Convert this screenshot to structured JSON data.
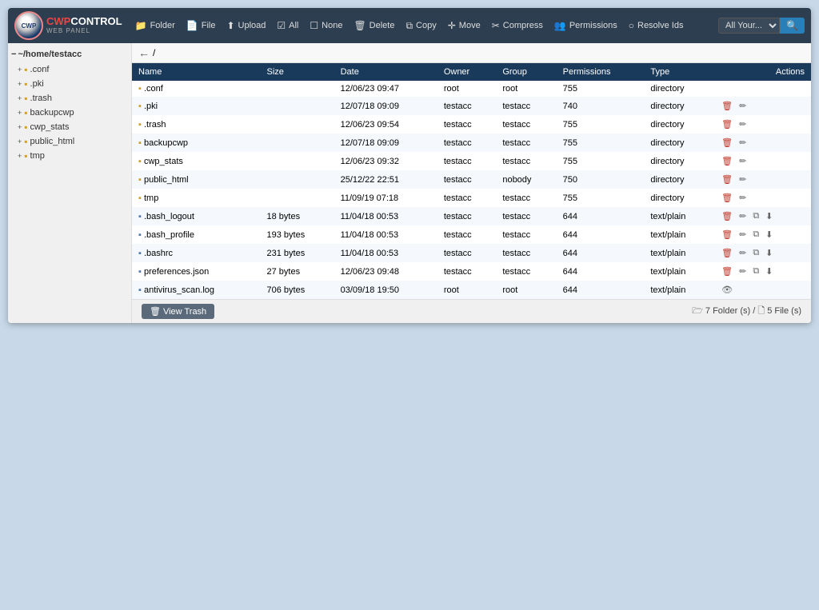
{
  "logo": {
    "cwp": "CWP",
    "control": "CONTROL",
    "sub": "WEB PANEL"
  },
  "toolbar": {
    "folder_label": "Folder",
    "file_label": "File",
    "upload_label": "Upload",
    "all_label": "All",
    "none_label": "None",
    "delete_label": "Delete",
    "copy_label": "Copy",
    "move_label": "Move",
    "compress_label": "Compress",
    "permissions_label": "Permissions",
    "resolve_ids_label": "Resolve Ids",
    "search_placeholder": "All Your...",
    "search_options": [
      "All Your..."
    ]
  },
  "sidebar": {
    "root_label": "~/home/testacc",
    "items": [
      {
        "name": ".conf",
        "indent": 1
      },
      {
        "name": ".pki",
        "indent": 1
      },
      {
        "name": ".trash",
        "indent": 1
      },
      {
        "name": "backupcwp",
        "indent": 1
      },
      {
        "name": "cwp_stats",
        "indent": 1
      },
      {
        "name": "public_html",
        "indent": 1
      },
      {
        "name": "tmp",
        "indent": 1
      }
    ]
  },
  "nav": {
    "back_char": "←",
    "separator": "/"
  },
  "table": {
    "headers": [
      "Name",
      "Size",
      "Date",
      "Owner",
      "Group",
      "Permissions",
      "Type",
      "Actions"
    ],
    "rows": [
      {
        "name": ".conf",
        "size": "",
        "date": "12/06/23 09:47",
        "owner": "root",
        "group": "root",
        "perms": "755",
        "type": "directory",
        "is_dir": true,
        "actions": []
      },
      {
        "name": ".pki",
        "size": "",
        "date": "12/07/18 09:09",
        "owner": "testacc",
        "group": "testacc",
        "perms": "740",
        "type": "directory",
        "is_dir": true,
        "actions": [
          "delete",
          "edit"
        ]
      },
      {
        "name": ".trash",
        "size": "",
        "date": "12/06/23 09:54",
        "owner": "testacc",
        "group": "testacc",
        "perms": "755",
        "type": "directory",
        "is_dir": true,
        "actions": [
          "delete",
          "edit"
        ]
      },
      {
        "name": "backupcwp",
        "size": "",
        "date": "12/07/18 09:09",
        "owner": "testacc",
        "group": "testacc",
        "perms": "755",
        "type": "directory",
        "is_dir": true,
        "actions": [
          "delete",
          "edit"
        ]
      },
      {
        "name": "cwp_stats",
        "size": "",
        "date": "12/06/23 09:32",
        "owner": "testacc",
        "group": "testacc",
        "perms": "755",
        "type": "directory",
        "is_dir": true,
        "actions": [
          "delete",
          "edit"
        ]
      },
      {
        "name": "public_html",
        "size": "",
        "date": "25/12/22 22:51",
        "owner": "testacc",
        "group": "nobody",
        "perms": "750",
        "type": "directory",
        "is_dir": true,
        "actions": [
          "delete",
          "edit"
        ]
      },
      {
        "name": "tmp",
        "size": "",
        "date": "11/09/19 07:18",
        "owner": "testacc",
        "group": "testacc",
        "perms": "755",
        "type": "directory",
        "is_dir": true,
        "actions": [
          "delete",
          "edit"
        ]
      },
      {
        "name": ".bash_logout",
        "size": "18 bytes",
        "date": "11/04/18 00:53",
        "owner": "testacc",
        "group": "testacc",
        "perms": "644",
        "type": "text/plain",
        "is_dir": false,
        "actions": [
          "delete",
          "edit",
          "copy",
          "download"
        ]
      },
      {
        "name": ".bash_profile",
        "size": "193 bytes",
        "date": "11/04/18 00:53",
        "owner": "testacc",
        "group": "testacc",
        "perms": "644",
        "type": "text/plain",
        "is_dir": false,
        "actions": [
          "delete",
          "edit",
          "copy",
          "download"
        ]
      },
      {
        "name": ".bashrc",
        "size": "231 bytes",
        "date": "11/04/18 00:53",
        "owner": "testacc",
        "group": "testacc",
        "perms": "644",
        "type": "text/plain",
        "is_dir": false,
        "actions": [
          "delete",
          "edit",
          "copy",
          "download"
        ]
      },
      {
        "name": "preferences.json",
        "size": "27 bytes",
        "date": "12/06/23 09:48",
        "owner": "testacc",
        "group": "testacc",
        "perms": "644",
        "type": "text/plain",
        "is_dir": false,
        "actions": [
          "delete",
          "edit",
          "copy",
          "download"
        ]
      },
      {
        "name": "antivirus_scan.log",
        "size": "706 bytes",
        "date": "03/09/18 19:50",
        "owner": "root",
        "group": "root",
        "perms": "644",
        "type": "text/plain",
        "is_dir": false,
        "actions": [
          "view"
        ]
      }
    ]
  },
  "footer": {
    "view_trash_label": "View Trash",
    "stats_label": "🗁 7 Folder (s) / 🗋 5 File (s)"
  }
}
